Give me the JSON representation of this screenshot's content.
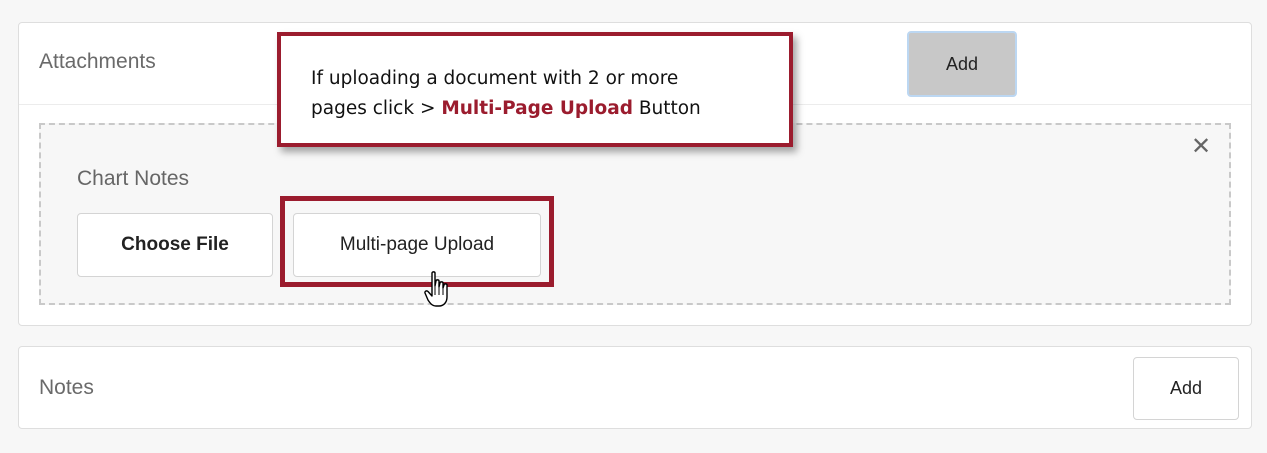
{
  "attachments": {
    "title": "Attachments",
    "add_label": "Add",
    "upload_item": {
      "label": "Chart Notes",
      "choose_file_label": "Choose File",
      "multi_page_label": "Multi-page Upload",
      "remove_icon": "close-icon"
    }
  },
  "callout": {
    "line1": "If uploading a document with 2 or more",
    "line2_prefix": "pages click > ",
    "line2_highlight": "Multi-Page Upload",
    "line2_suffix": " Button"
  },
  "notes": {
    "title": "Notes",
    "add_label": "Add"
  },
  "colors": {
    "highlight": "#9b1c2e",
    "page_background": "#f7f7f7",
    "add_button_active": "#c8c8c8"
  }
}
